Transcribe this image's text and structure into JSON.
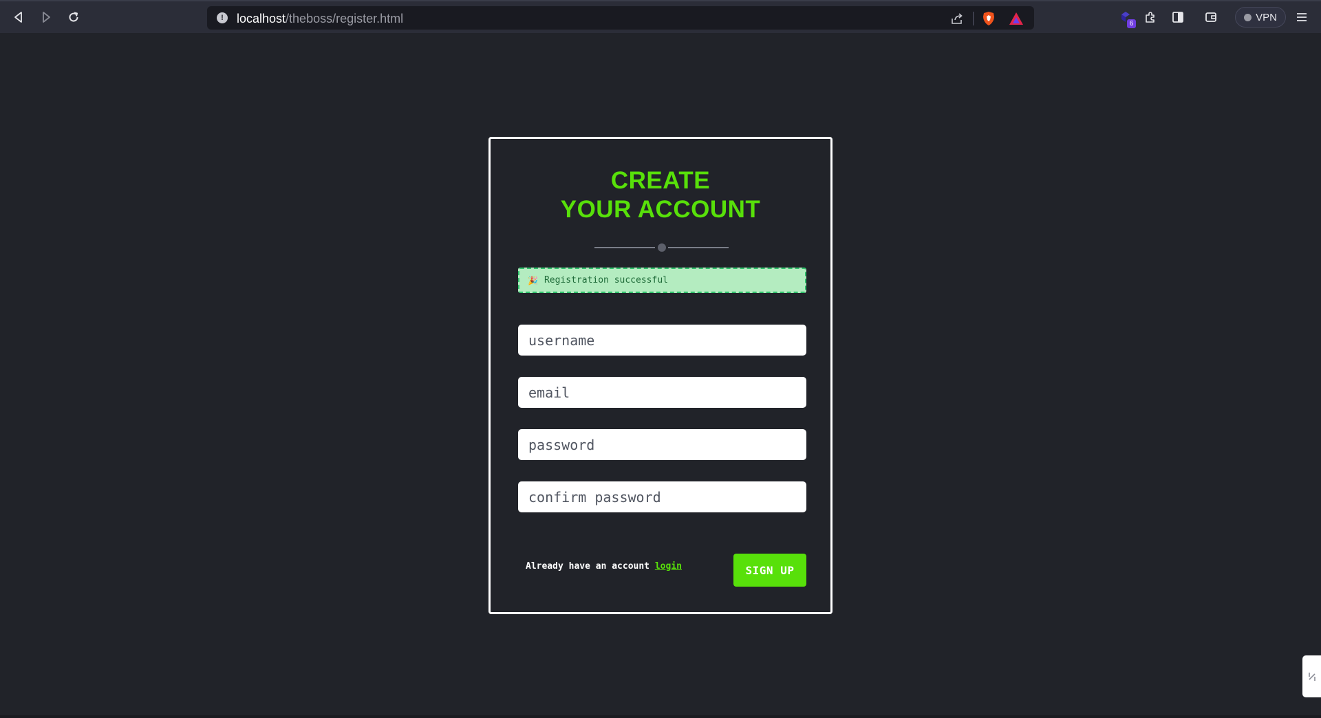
{
  "browser": {
    "url_host": "localhost",
    "url_path": "/theboss/register.html",
    "extensions_badge": "6",
    "vpn_label": "VPN"
  },
  "page": {
    "title_line1": "CREATE",
    "title_line2": "YOUR ACCOUNT",
    "alert": {
      "icon": "🎉",
      "text": "Registration successful"
    },
    "fields": {
      "username_placeholder": "username",
      "email_placeholder": "email",
      "password_placeholder": "password",
      "confirm_placeholder": "confirm password"
    },
    "already_text": "Already have an account",
    "login_link": "login",
    "signup_label": "SIGN UP"
  },
  "colors": {
    "accent": "#58e00a",
    "background": "#212329",
    "alert_bg": "#b4ecc0",
    "alert_border": "#2ec06a"
  },
  "icons": [
    "back-icon",
    "forward-icon",
    "reload-icon",
    "site-info-icon",
    "share-icon",
    "brave-shields-icon",
    "brave-rewards-icon",
    "extensions-badge-icon",
    "puzzle-icon",
    "sidebar-icon",
    "wallet-icon",
    "vpn-status-icon",
    "menu-icon",
    "party-popper-icon"
  ]
}
